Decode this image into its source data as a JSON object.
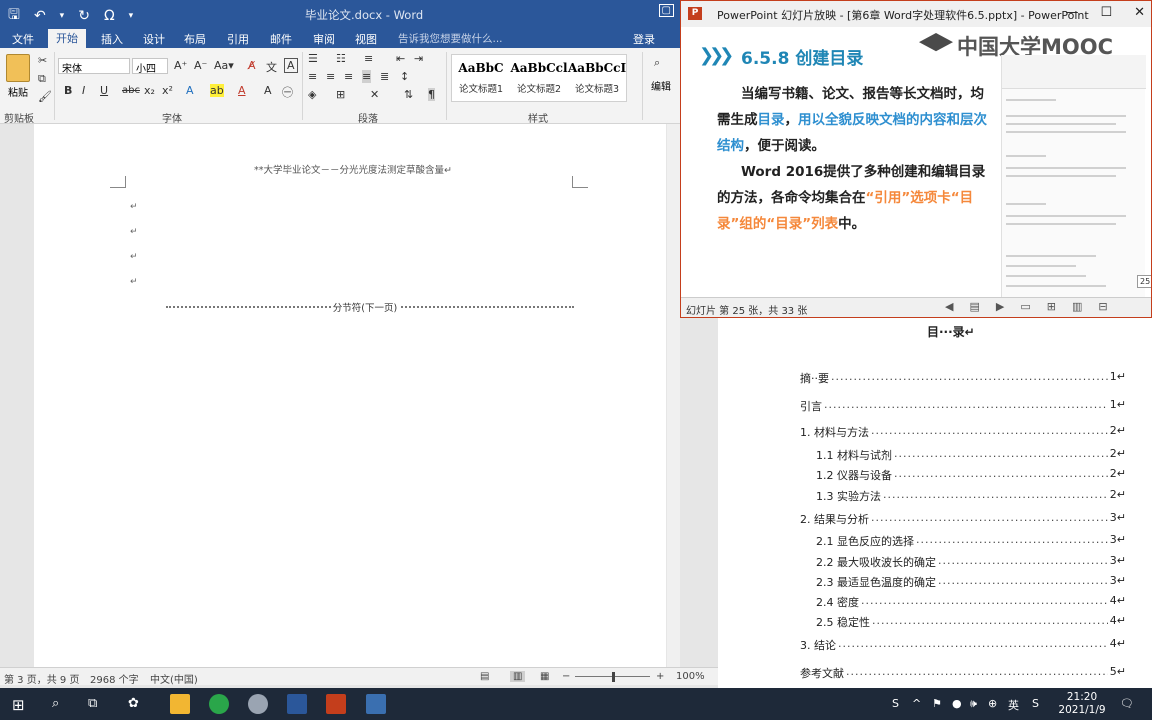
{
  "word": {
    "title": "毕业论文.docx - Word",
    "qat": {
      "save_icon": "🖫",
      "undo_icon": "↶",
      "redo_icon": "↻",
      "omega": "Ω"
    },
    "tabs": [
      "文件",
      "开始",
      "插入",
      "设计",
      "布局",
      "引用",
      "邮件",
      "审阅",
      "视图"
    ],
    "active_tab": "开始",
    "tell_me": "告诉我您想要做什么...",
    "login": "登录",
    "ribbon": {
      "paste": "粘贴",
      "clipboard": "剪贴板",
      "font_group": "字体",
      "paragraph_group": "段落",
      "styles_group": "样式",
      "edit": "编辑",
      "font_name": "宋体",
      "font_size": "小四",
      "styles": [
        {
          "sample": "AaBbC",
          "name": "论文标题1"
        },
        {
          "sample": "AaBbCcl",
          "name": "论文标题2"
        },
        {
          "sample": "AaBbCcI",
          "name": "论文标题3"
        }
      ]
    },
    "page_header": "**大学毕业论文－－分光光度法测定草酸含量↵",
    "para_marks": [
      "↵",
      "↵",
      "↵",
      "↵"
    ],
    "section_break": "分节符(下一页)",
    "status": {
      "page": "第 3 页，共 9 页",
      "words": "2968 个字",
      "lang": "中文(中国)",
      "zoom": "100%"
    }
  },
  "ppt": {
    "title": "PowerPoint 幻灯片放映 - [第6章 Word字处理软件6.5.pptx] - PowerPoint",
    "logo": "P",
    "slide_heading": "6.5.8 创建目录",
    "watermark": "中国大学MOOC",
    "para1_a": "当编写书籍、论文、报告等长文档时，均需生成",
    "para1_b": "目录",
    "para1_c": "，",
    "para1_d": "用以全貌反映文档的内容和层次结构",
    "para1_e": "，便于阅读。",
    "para2_a": "Word 2016提供了多种创建和编辑目录的方法，各命令均集合在",
    "para2_b": "“引用”选项卡“目录”组的“目录”列表",
    "para2_c": "中。",
    "slide_number": "25",
    "status": "幻灯片 第 25 张，共 33 张"
  },
  "toc": {
    "title": "目···录↵",
    "rows": [
      {
        "label": "摘··要",
        "page": "1↵",
        "level": 1
      },
      {
        "label": "引言",
        "page": "1↵",
        "level": 1
      },
      {
        "label": "1. 材料与方法",
        "page": "2↵",
        "level": 1
      },
      {
        "label": "1.1 材料与试剂",
        "page": "2↵",
        "level": 2
      },
      {
        "label": "1.2 仪器与设备",
        "page": "2↵",
        "level": 2
      },
      {
        "label": "1.3 实验方法",
        "page": "2↵",
        "level": 2
      },
      {
        "label": "2. 结果与分析",
        "page": "3↵",
        "level": 1
      },
      {
        "label": "2.1 显色反应的选择",
        "page": "3↵",
        "level": 2
      },
      {
        "label": "2.2 最大吸收波长的确定",
        "page": "3↵",
        "level": 2
      },
      {
        "label": "2.3 最适显色温度的确定",
        "page": "3↵",
        "level": 2
      },
      {
        "label": "2.4 密度",
        "page": "4↵",
        "level": 2
      },
      {
        "label": "2.5 稳定性",
        "page": "4↵",
        "level": 2
      },
      {
        "label": "3. 结论",
        "page": "4↵",
        "level": 1
      },
      {
        "label": "参考文献",
        "page": "5↵",
        "level": 1
      }
    ]
  },
  "taskbar": {
    "time": "21:20",
    "date": "2021/1/9",
    "ime": "英"
  }
}
